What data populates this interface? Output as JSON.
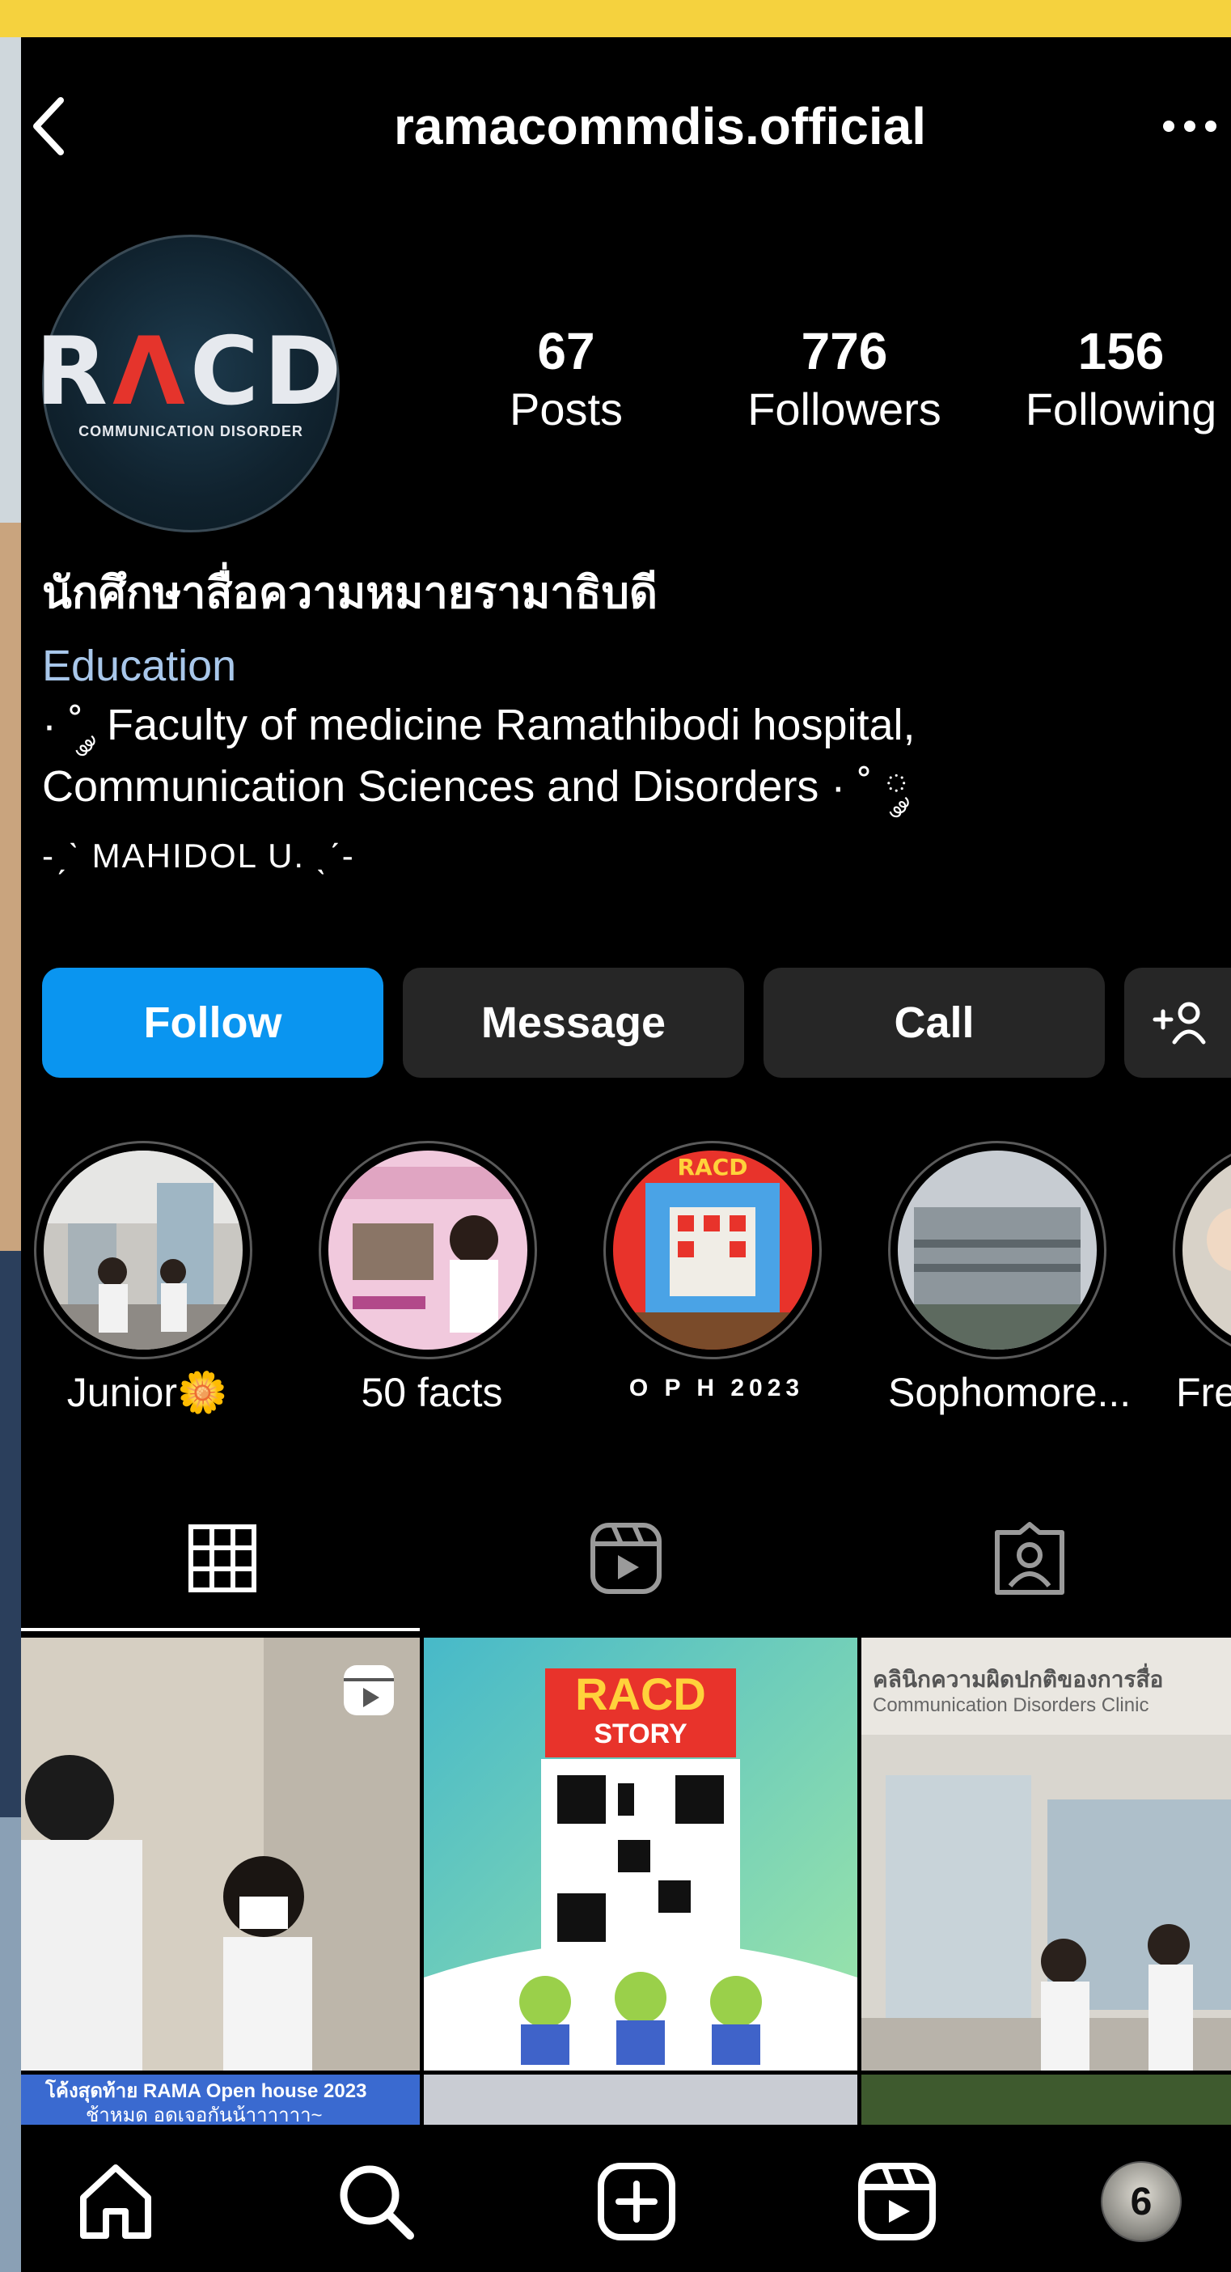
{
  "header": {
    "title": "ramacommdis.official",
    "back_icon": "chevron-left-icon",
    "more_label": "···"
  },
  "profile": {
    "avatar_logo": "RACD",
    "avatar_logo_parts": [
      "R",
      "Λ",
      "CD"
    ],
    "avatar_sub": "COMMUNICATION DISORDER",
    "stats": [
      {
        "value": "67",
        "label": "Posts"
      },
      {
        "value": "776",
        "label": "Followers"
      },
      {
        "value": "156",
        "label": "Following"
      }
    ],
    "name": "นักศึกษาสื่อความหมายรามาธิบดี",
    "category": "Education",
    "bio_lines": [
      "· ˚ ༘ Faculty of medicine Ramathibodi hospital,",
      "Communication Sciences and Disorders · ˚ ༘",
      "-ˏˋ MAHIDOL U. ˎˊ-"
    ]
  },
  "actions": {
    "follow": "Follow",
    "message": "Message",
    "call": "Call",
    "add_person_icon": "add-person-icon"
  },
  "highlights": [
    {
      "label": "Junior🌼"
    },
    {
      "label": "50 facts"
    },
    {
      "label": "O P H  2023"
    },
    {
      "label": "Sophomore..."
    },
    {
      "label": "Fres"
    }
  ],
  "tabs": [
    "grid-icon",
    "reels-icon",
    "tagged-icon"
  ],
  "posts": [
    {
      "text": ""
    },
    {
      "text": "RACD",
      "sub": "STORY"
    },
    {
      "text": "คลินิกความผิดปกติของการสื่อ",
      "sub": "Communication Disorders Clinic"
    },
    {
      "text": "โค้งสุดท้าย RAMA Open house 2023",
      "sub": "ช้าหมด อดเจอกันน้าาาาาา~"
    }
  ],
  "nav": [
    "home-icon",
    "search-icon",
    "create-icon",
    "reels-icon",
    "profile-avatar"
  ],
  "nav_avatar_text": "6"
}
